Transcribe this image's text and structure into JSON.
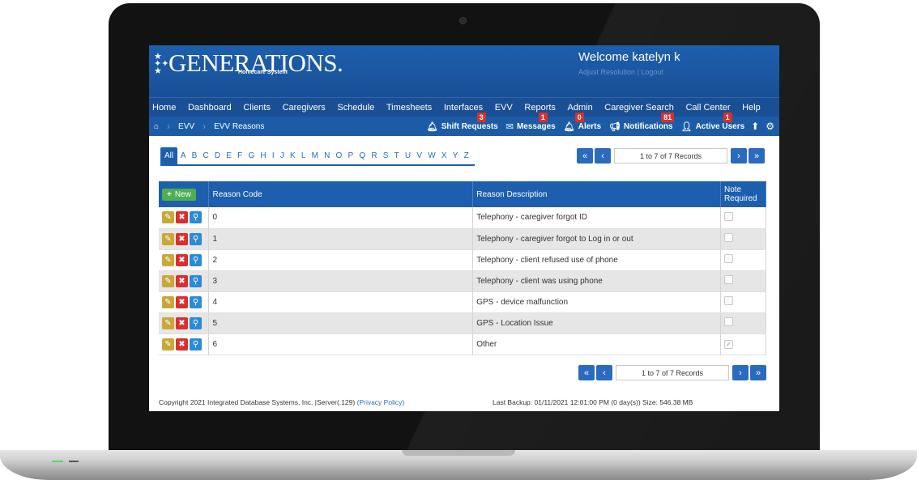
{
  "app": {
    "logo_text": "GENERATIONS.",
    "logo_sub": "Homecare System",
    "welcome": "Welcome katelyn k",
    "adjust_resolution": "Adjust Resolution",
    "logout": "Logout",
    "link_separator": "|"
  },
  "main_nav": [
    "Home",
    "Dashboard",
    "Clients",
    "Caregivers",
    "Schedule",
    "Timesheets",
    "Interfaces",
    "EVV",
    "Reports",
    "Admin",
    "Caregiver Search",
    "Call Center",
    "Help"
  ],
  "breadcrumb": {
    "level1": "EVV",
    "level2": "EVV Reasons"
  },
  "notifications_bar": {
    "shift_requests": {
      "label": "Shift Requests",
      "count": "3"
    },
    "messages": {
      "label": "Messages",
      "count": "1"
    },
    "alerts": {
      "label": "Alerts",
      "count": "0"
    },
    "notifications": {
      "label": "Notifications",
      "count": "81"
    },
    "active_users": {
      "label": "Active Users",
      "count": "1"
    }
  },
  "alpha_filter": [
    "All",
    "A",
    "B",
    "C",
    "D",
    "E",
    "F",
    "G",
    "H",
    "I",
    "J",
    "K",
    "L",
    "M",
    "N",
    "O",
    "P",
    "Q",
    "R",
    "S",
    "T",
    "U",
    "V",
    "W",
    "X",
    "Y",
    "Z"
  ],
  "pager": {
    "first": "«",
    "prev": "‹",
    "next": "›",
    "last": "»",
    "info": "1 to 7 of 7 Records"
  },
  "table": {
    "new_label": "New",
    "headers": {
      "reason_code": "Reason Code",
      "reason_description": "Reason Description",
      "note_required": "Note Required"
    },
    "rows": [
      {
        "code": "0",
        "description": "Telephony - caregiver forgot ID",
        "note_required": false
      },
      {
        "code": "1",
        "description": "Telephony - caregiver forgot to Log in or out",
        "note_required": false
      },
      {
        "code": "2",
        "description": "Telephony - client refused use of phone",
        "note_required": false
      },
      {
        "code": "3",
        "description": "Telephony - client was using phone",
        "note_required": false
      },
      {
        "code": "4",
        "description": "GPS - device malfunction",
        "note_required": false
      },
      {
        "code": "5",
        "description": "GPS - Location Issue",
        "note_required": false
      },
      {
        "code": "6",
        "description": "Other",
        "note_required": true
      }
    ]
  },
  "footer": {
    "copyright": "Copyright 2021 Integrated Database Systems, Inc. |Server(.129)",
    "privacy_link": "(Privacy Policy)",
    "backup": "Last Backup: 01/11/2021 12:01:00 PM (0 day(s)) Size: 546.38 MB"
  },
  "icons": {
    "home": "home-icon",
    "bell": "bell-icon",
    "envelope": "envelope-icon",
    "megaphone": "megaphone-icon",
    "user": "user-icon",
    "upload": "upload-icon",
    "gear": "gear-icon",
    "edit": "pencil-icon",
    "delete": "x-icon",
    "view": "magnifier-icon"
  },
  "colors": {
    "header_blue": "#1d5fae",
    "nav_blue": "#1a4f95",
    "badge_red": "#d9302c",
    "new_green": "#4caf50",
    "link_blue": "#2a6bc0"
  }
}
